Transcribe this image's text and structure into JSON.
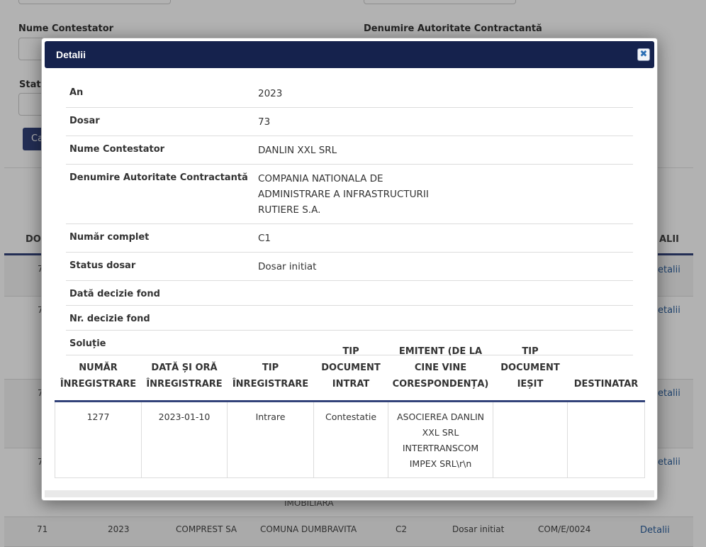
{
  "background": {
    "filters": {
      "contestator_label": "Nume Contestator",
      "autoritate_label": "Denumire Autoritate Contractantă",
      "status_label": "Status",
      "search_button": "Ca"
    },
    "table": {
      "head_left": "DO",
      "head_right": "ALII",
      "row_ids": [
        "7",
        "7",
        "7",
        "7"
      ],
      "link_label": "etalii",
      "fragment": "IMOBILIARA",
      "last_row": [
        "71",
        "2023",
        "COMPREST SA",
        "COMUNA DUMBRAVITA",
        "C2",
        "Dosar initiat",
        "COM/E/0024",
        "Detalii"
      ]
    }
  },
  "modal": {
    "title": "Detalii",
    "close_icon": "close-icon",
    "fields": [
      {
        "label": "An",
        "value": "2023"
      },
      {
        "label": "Dosar",
        "value": "73"
      },
      {
        "label": "Nume Contestator",
        "value": "DANLIN XXL SRL"
      },
      {
        "label": "Denumire Autoritate Contractantă",
        "value": "COMPANIA NATIONALA DE ADMINISTRARE A INFRASTRUCTURII RUTIERE S.A."
      },
      {
        "label": "Număr complet",
        "value": "C1"
      },
      {
        "label": "Status dosar",
        "value": "Dosar initiat"
      },
      {
        "label": "Dată decizie fond",
        "value": ""
      },
      {
        "label": "Nr. decizie fond",
        "value": ""
      },
      {
        "label": "Soluție",
        "value": ""
      }
    ],
    "documents": {
      "columns": [
        "NUMĂR ÎNREGISTRARE",
        "DATĂ ȘI ORĂ ÎNREGISTRARE",
        "TIP ÎNREGISTRARE",
        "TIP DOCUMENT INTRAT",
        "EMITENT (DE LA CINE VINE CORESPONDENȚA)",
        "TIP DOCUMENT IEȘIT",
        "DESTINATAR"
      ],
      "rows": [
        [
          "1277",
          "2023-01-10",
          "Intrare",
          "Contestatie",
          "ASOCIEREA DANLIN XXL SRL INTERTRANSCOM IMPEX SRL\\r\\n",
          "",
          ""
        ]
      ]
    }
  }
}
